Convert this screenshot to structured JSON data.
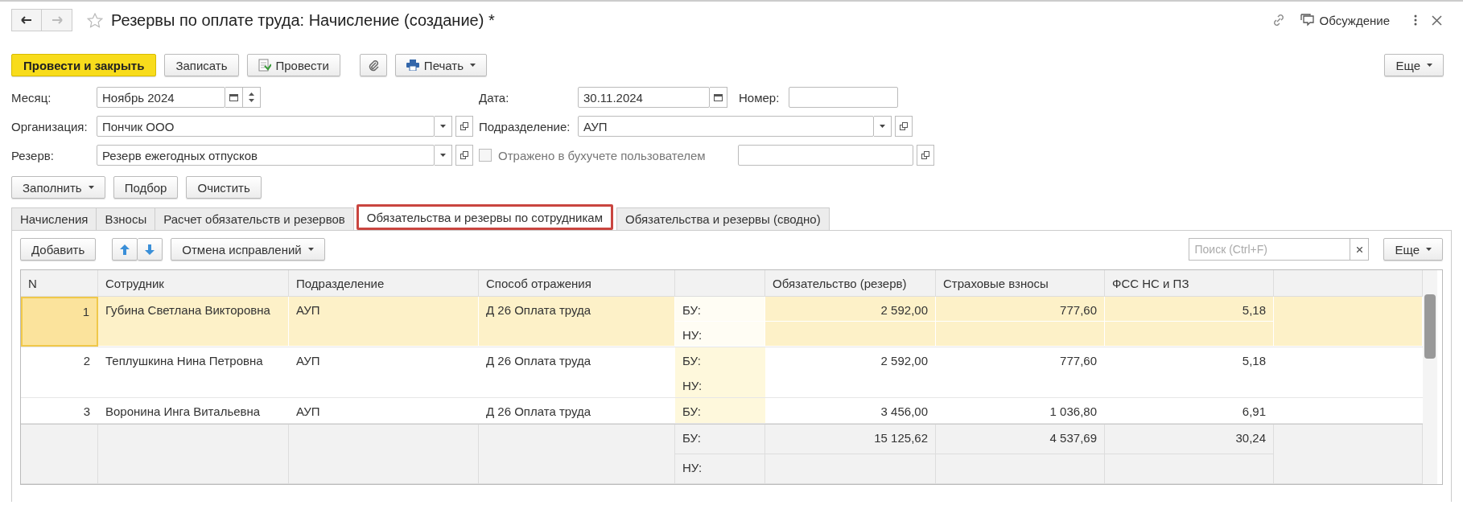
{
  "window": {
    "title": "Резервы по оплате труда: Начисление (создание) *",
    "discussion": "Обсуждение"
  },
  "toolbar": [
    {
      "kind": "primary",
      "label": "Провести и закрыть"
    },
    {
      "kind": "plain",
      "label": "Записать"
    },
    {
      "kind": "post",
      "label": "Провести"
    },
    {
      "kind": "attach"
    },
    {
      "kind": "print",
      "label": "Печать"
    }
  ],
  "more_button": "Еще",
  "form": {
    "month": {
      "label": "Месяц:",
      "value": "Ноябрь 2024"
    },
    "date": {
      "label": "Дата:",
      "value": "30.11.2024"
    },
    "number": {
      "label": "Номер:"
    },
    "organization": {
      "label": "Организация:",
      "value": "Пончик ООО"
    },
    "subdivision": {
      "label": "Подразделение:",
      "value": "АУП"
    },
    "reserve": {
      "label": "Резерв:",
      "value": "Резерв ежегодных отпусков"
    },
    "reflected": {
      "label": "Отражено в бухучете пользователем",
      "checked": false
    }
  },
  "fill_buttons": [
    {
      "label": "Заполнить",
      "dropdown": true
    },
    {
      "label": "Подбор",
      "dropdown": false
    },
    {
      "label": "Очистить",
      "dropdown": false
    }
  ],
  "tabs": [
    {
      "label": "Начисления",
      "selected": false
    },
    {
      "label": "Взносы",
      "selected": false
    },
    {
      "label": "Расчет обязательств и резервов",
      "selected": false
    },
    {
      "label": "Обязательства и резервы по сотрудникам",
      "selected": true
    },
    {
      "label": "Обязательства и резервы (сводно)",
      "selected": false
    }
  ],
  "table_toolbar": {
    "add": "Добавить",
    "undo": "Отмена исправлений",
    "search_placeholder": "Поиск (Ctrl+F)",
    "more": "Еще"
  },
  "table": {
    "columns": [
      "N",
      "Сотрудник",
      "Подразделение",
      "Способ отражения",
      "",
      "Обязательство (резерв)",
      "Страховые взносы",
      "ФСС НС и ПЗ"
    ],
    "rows": [
      {
        "n": "1",
        "employee": "Губина Светлана Викторовна",
        "subdivision": "АУП",
        "method": "Д 26 Оплата труда",
        "selected": true,
        "lines": [
          {
            "label": "БУ:",
            "values": [
              "2 592,00",
              "777,60",
              "5,18"
            ]
          },
          {
            "label": "НУ:"
          }
        ]
      },
      {
        "n": "2",
        "employee": "Теплушкина Нина Петровна",
        "subdivision": "АУП",
        "method": "Д 26 Оплата труда",
        "selected": false,
        "lines": [
          {
            "label": "БУ:",
            "values": [
              "2 592,00",
              "777,60",
              "5,18"
            ]
          },
          {
            "label": "НУ:"
          }
        ]
      },
      {
        "n": "3",
        "employee": "Воронина Инга Витальевна",
        "subdivision": "АУП",
        "method": "Д 26 Оплата труда",
        "selected": false,
        "lines": [
          {
            "label": "БУ:",
            "values": [
              "3 456,00",
              "1 036,80",
              "6,91"
            ]
          }
        ]
      }
    ],
    "totals": [
      {
        "label": "БУ:",
        "values": [
          "15 125,62",
          "4 537,69",
          "30,24"
        ]
      },
      {
        "label": "НУ:"
      }
    ]
  }
}
